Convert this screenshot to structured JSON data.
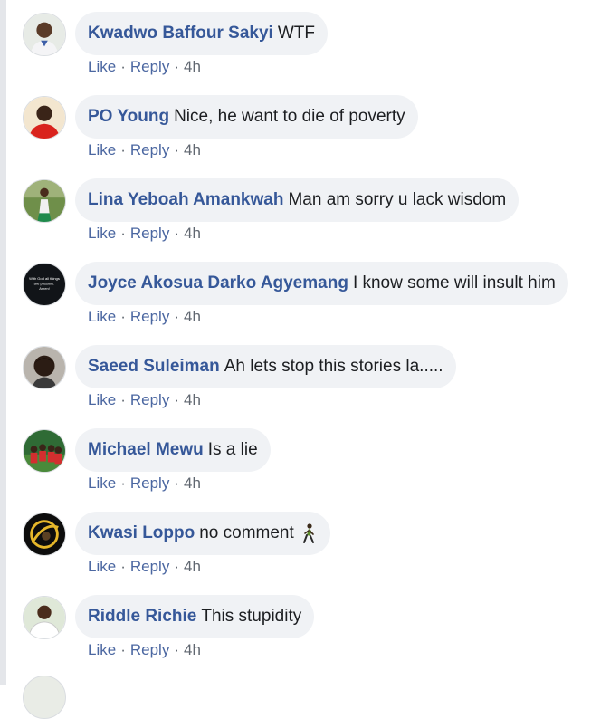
{
  "comments": [
    {
      "author": "Kwadwo Baffour Sakyi",
      "text": "WTF",
      "like": "Like",
      "reply": "Reply",
      "sep": "·",
      "time": "4h",
      "avatar": "person-avatar-1"
    },
    {
      "author": "PO Young",
      "text": "Nice, he want to die of poverty",
      "like": "Like",
      "reply": "Reply",
      "sep": "·",
      "time": "4h",
      "avatar": "person-avatar-2"
    },
    {
      "author": "Lina Yeboah Amankwah",
      "text": "Man am sorry u lack wisdom",
      "like": "Like",
      "reply": "Reply",
      "sep": "·",
      "time": "4h",
      "avatar": "person-avatar-3"
    },
    {
      "author": "Joyce Akosua Darko Agyemang",
      "text": "I know some will insult him",
      "like": "Like",
      "reply": "Reply",
      "sep": "·",
      "time": "4h",
      "avatar": "text-avatar-4",
      "avatar_text": [
        "With God all things",
        "are possible.",
        "Amen!"
      ]
    },
    {
      "author": "Saeed Suleiman",
      "text": "Ah lets stop this stories la.....",
      "like": "Like",
      "reply": "Reply",
      "sep": "·",
      "time": "4h",
      "avatar": "person-avatar-5"
    },
    {
      "author": "Michael Mewu",
      "text": "Is a lie",
      "like": "Like",
      "reply": "Reply",
      "sep": "·",
      "time": "4h",
      "avatar": "group-avatar-6"
    },
    {
      "author": "Kwasi Loppo",
      "text": "no comment",
      "like": "Like",
      "reply": "Reply",
      "sep": "·",
      "time": "4h",
      "avatar": "logo-avatar-7",
      "emoji": "person-walking-emoji"
    },
    {
      "author": "Riddle Richie",
      "text": "This stupidity",
      "like": "Like",
      "reply": "Reply",
      "sep": "·",
      "time": "4h",
      "avatar": "person-avatar-8"
    }
  ],
  "colors": {
    "author": "#365899",
    "bubble": "#f0f2f5",
    "action_link": "#4b67a1",
    "meta": "#606770"
  }
}
